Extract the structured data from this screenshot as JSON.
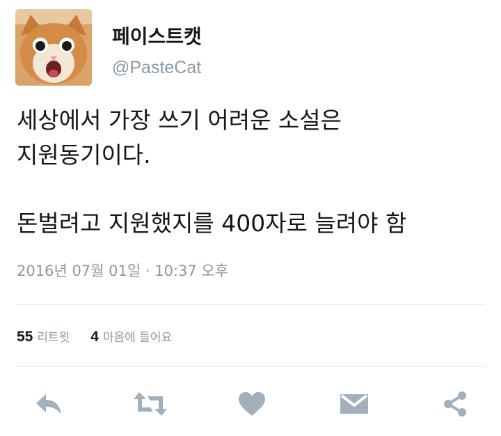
{
  "tweet": {
    "author": {
      "display_name": "페이스트캣",
      "handle": "@PasteCat"
    },
    "lines": [
      "세상에서 가장 쓰기 어려운 소설은",
      "지원동기이다.",
      "",
      "돈벌려고 지원했지를 400자로 늘려야 함"
    ],
    "timestamp": "2016년 07월 01일 · 10:37 오후",
    "stats": {
      "retweet_count": "55",
      "retweet_label": "리트윗",
      "like_count": "4",
      "like_label": "마음에 들어요"
    },
    "actions": [
      "reply-icon",
      "retweet-icon",
      "heart-icon",
      "direct-message-icon",
      "share-icon"
    ],
    "colors": {
      "text": "#14171a",
      "muted": "#8899a6",
      "icon": "#a2b0bc",
      "divider": "#e1e8ed"
    }
  }
}
